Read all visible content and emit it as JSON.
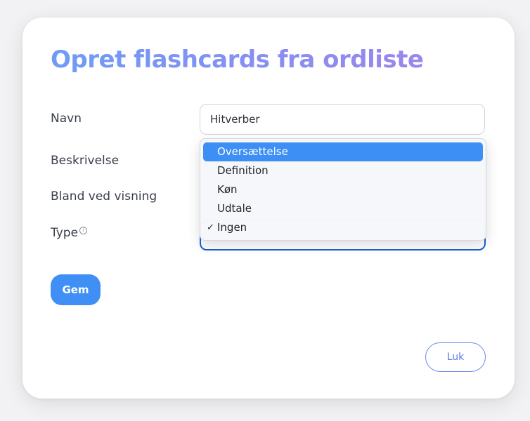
{
  "dialog": {
    "title": "Opret flashcards fra ordliste"
  },
  "form": {
    "name_label": "Navn",
    "name_value": "Hitverber",
    "description_label": "Beskrivelse",
    "shuffle_label": "Bland ved visning",
    "type_label": "Type",
    "type_info_icon": "info-icon",
    "type_selected": "Ingen",
    "type_options": [
      {
        "label": "Oversættelse",
        "highlighted": true,
        "checked": false
      },
      {
        "label": "Definition",
        "highlighted": false,
        "checked": false
      },
      {
        "label": "Køn",
        "highlighted": false,
        "checked": false
      },
      {
        "label": "Udtale",
        "highlighted": false,
        "checked": false
      },
      {
        "label": "Ingen",
        "highlighted": false,
        "checked": true
      }
    ],
    "checkmark": "✓"
  },
  "buttons": {
    "save_label": "Gem",
    "close_label": "Luk"
  },
  "colors": {
    "title_gradient_start": "#6e9cf5",
    "title_gradient_end": "#9a86ee",
    "primary": "#3f8ff5",
    "highlight": "#3d8ff6",
    "focus_border": "#1a5fd6",
    "outline_button": "#6d8bf0"
  }
}
